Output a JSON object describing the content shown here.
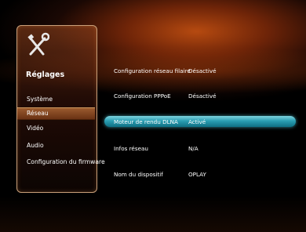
{
  "sidebar": {
    "title": "Réglages",
    "items": [
      {
        "label": "Système"
      },
      {
        "label": "Réseau"
      },
      {
        "label": "Vidéo"
      },
      {
        "label": "Audio"
      },
      {
        "label": "Configuration du firmware"
      }
    ],
    "selected_index": 1
  },
  "settings": [
    {
      "label": "Configuration réseau filaire",
      "value": "Désactivé"
    },
    {
      "label": "Configuration PPPoE",
      "value": "Désactivé"
    },
    {
      "label": "Moteur de rendu DLNA",
      "value": "Activé"
    },
    {
      "label": "Infos réseau",
      "value": "N/A"
    },
    {
      "label": "Nom du dispositif",
      "value": "OPLAY"
    }
  ],
  "highlighted_setting_index": 2,
  "colors": {
    "highlight": "#2a9eb2",
    "accent": "#b64a10"
  },
  "icons": {
    "settings": "wrench-screwdriver-icon"
  }
}
